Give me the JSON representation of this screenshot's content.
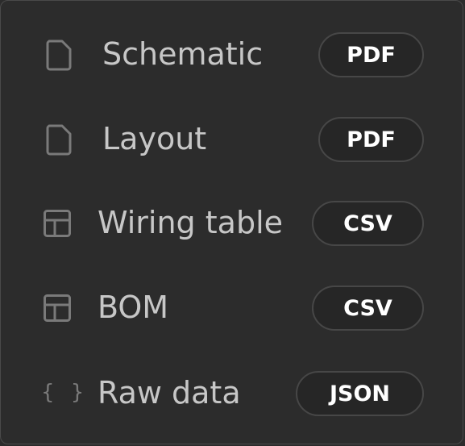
{
  "menu": {
    "items": [
      {
        "label": "Schematic",
        "format": "PDF",
        "icon": "file-icon"
      },
      {
        "label": "Layout",
        "format": "PDF",
        "icon": "file-icon"
      },
      {
        "label": "Wiring table",
        "format": "CSV",
        "icon": "table-icon"
      },
      {
        "label": "BOM",
        "format": "CSV",
        "icon": "table-icon"
      },
      {
        "label": "Raw data",
        "format": "JSON",
        "icon": "braces-icon",
        "icon_glyph": "{ }"
      }
    ]
  },
  "colors": {
    "background": "#2c2c2c",
    "text": "#c7c7c7",
    "icon": "#7a7a7a",
    "badge_border": "#474747",
    "badge_text": "#ffffff"
  }
}
